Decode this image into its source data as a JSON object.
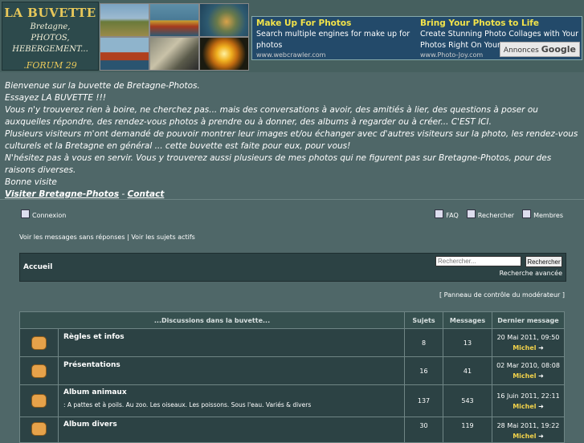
{
  "header": {
    "logo": {
      "title": "LA BUVETTE",
      "lines": [
        "Bretagne,",
        "PHOTOS,",
        "HEBERGEMENT..."
      ],
      "forum": ".FORUM 29"
    },
    "ads": [
      {
        "title": "Make Up For Photos",
        "text": "Search multiple engines for make up for photos",
        "url": "www.webcrawler.com"
      },
      {
        "title": "Bring Your Photos to Life",
        "text": "Create Stunning Photo Collages with Your Photos Right On Your Screen!",
        "url": "www.Photo-Joy.com"
      }
    ],
    "ads_badge_prefix": "Annonces",
    "ads_badge_brand": "Google"
  },
  "welcome": {
    "lines": [
      "Bienvenue sur la buvette de Bretagne-Photos.",
      "Essayez LA BUVETTE !!!",
      "Vous n'y trouverez rien à boire, ne cherchez pas... mais des conversations à avoir, des amitiés à lier, des questions à poser ou auxquelles répondre, des rendez-vous photos à prendre ou à donner, des albums à regarder ou à créer... C'EST ICI.",
      "Plusieurs visiteurs m'ont demandé de pouvoir montrer leur images et/ou échanger avec d'autres visiteurs sur la photo, les rendez-vous culturels et la Bretagne en général ... cette buvette est faite pour eux, pour vous!",
      "N'hésitez pas à vous en servir. Vous y trouverez aussi plusieurs de mes photos qui ne figurent pas sur Bretagne-Photos, pour des raisons diverses.",
      "Bonne visite"
    ],
    "link_visit": "Visiter Bretagne-Photos",
    "separator": "-",
    "link_contact": "Contact"
  },
  "nav": {
    "login": "Connexion",
    "faq": "FAQ",
    "search": "Rechercher",
    "members": "Membres"
  },
  "sublinks": {
    "unanswered": "Voir les messages sans réponses",
    "sep": "|",
    "active": "Voir les sujets actifs"
  },
  "bar": {
    "title": "Accueil",
    "search_placeholder": "Rechercher...",
    "search_button": "Rechercher",
    "advanced": "Recherche avancée"
  },
  "mod_panel": "[ Panneau de contrôle du modérateur ]",
  "table": {
    "headers": [
      "...Discussions dans la buvette...",
      "Sujets",
      "Messages",
      "Dernier message"
    ],
    "rows": [
      {
        "name": "Règles et infos",
        "desc": "",
        "topics": "8",
        "posts": "13",
        "last_date": "20 Mai 2011, 09:50",
        "last_author": "Michel"
      },
      {
        "name": "Présentations",
        "desc": "",
        "topics": "16",
        "posts": "41",
        "last_date": "02 Mar 2010, 08:08",
        "last_author": "Michel"
      },
      {
        "name": "Album animaux",
        "desc": ": A pattes et à poils. Au zoo. Les oiseaux. Les poissons. Sous l'eau. Variés & divers",
        "topics": "137",
        "posts": "543",
        "last_date": "16 Juin 2011, 22:11",
        "last_author": "Michel"
      },
      {
        "name": "Album divers",
        "desc": "",
        "topics": "30",
        "posts": "119",
        "last_date": "28 Mai 2011, 19:22",
        "last_author": "Michel"
      }
    ]
  },
  "colors": {
    "background": "#4f6768",
    "panel": "#2c4244",
    "accent_yellow": "#f2d24a",
    "ad_background": "#234a6a"
  }
}
